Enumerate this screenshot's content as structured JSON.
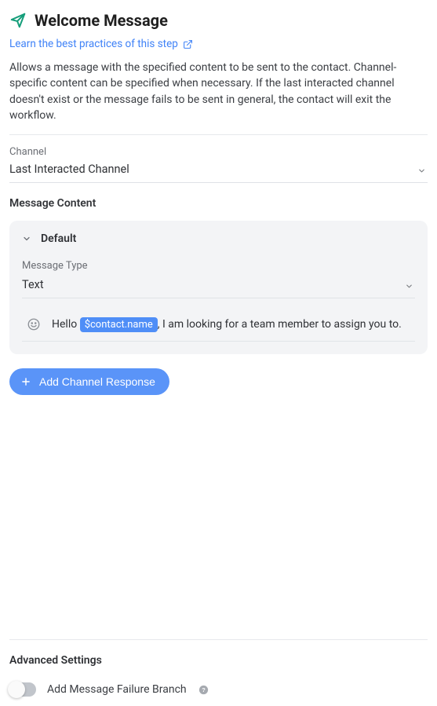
{
  "header": {
    "title": "Welcome Message"
  },
  "learn_link": {
    "text": "Learn the best practices of this step"
  },
  "description": "Allows a message with the specified content to be sent to the contact. Channel-specific content can be specified when necessary. If the last interacted channel doesn't exist or the message fails to be sent in general, the contact will exit the workflow.",
  "channel": {
    "label": "Channel",
    "value": "Last Interacted Channel"
  },
  "message_content": {
    "label": "Message Content",
    "default_title": "Default",
    "type_label": "Message Type",
    "type_value": "Text",
    "message_prefix": "Hello ",
    "message_token": "$contact.name",
    "message_suffix": ", I am looking for a team member to assign you to."
  },
  "add_button": {
    "label": "Add Channel Response"
  },
  "advanced": {
    "title": "Advanced Settings",
    "toggle_label": "Add Message Failure Branch"
  },
  "icons": {
    "send": "send-icon",
    "external": "external-link-icon",
    "chevron_down": "chevron-down-icon",
    "emoji": "emoji-icon",
    "plus": "plus-icon",
    "help": "help-icon"
  }
}
